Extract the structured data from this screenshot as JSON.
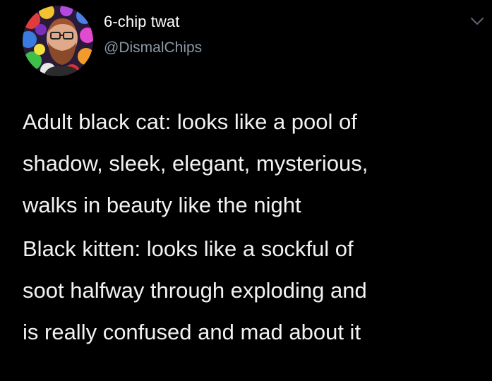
{
  "author": {
    "display_name": "6-chip twat",
    "handle": "@DismalChips",
    "avatar_icon": "avatar-photo-icon"
  },
  "menu": {
    "icon": "chevron-down-icon"
  },
  "tweet": {
    "paragraphs": [
      {
        "lines": [
          "Adult black cat: looks like a pool of",
          "shadow, sleek, elegant, mysterious,",
          "walks in beauty like the night"
        ]
      },
      {
        "lines": [
          "Black kitten: looks like a sockful of",
          "soot halfway through exploding and",
          "is really confused and mad about it"
        ]
      }
    ]
  },
  "colors": {
    "background": "#000000",
    "primary_text": "#ffffff",
    "secondary_text": "#8b98a5"
  }
}
